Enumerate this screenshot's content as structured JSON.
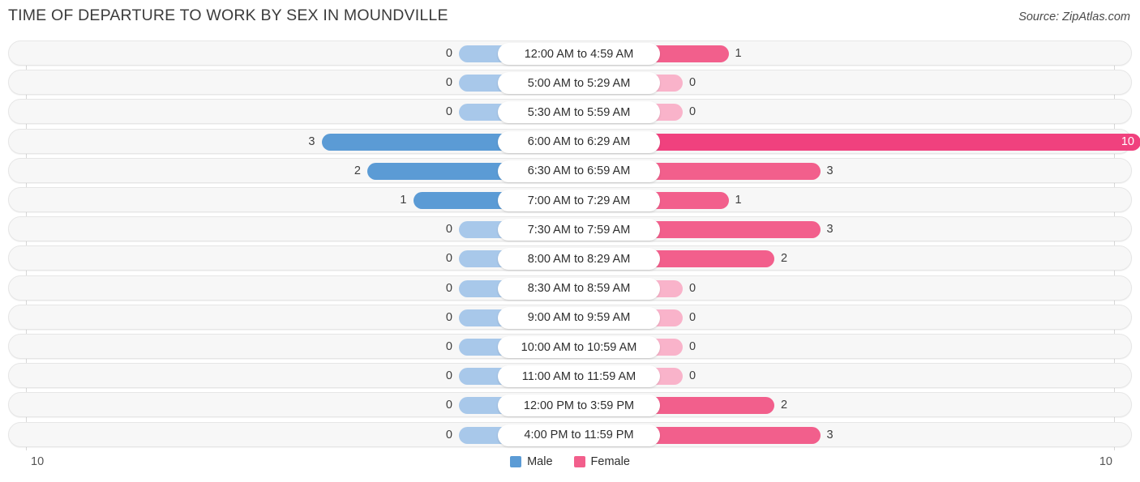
{
  "header": {
    "title": "TIME OF DEPARTURE TO WORK BY SEX IN MOUNDVILLE",
    "source": "Source: ZipAtlas.com"
  },
  "legend": {
    "male_label": "Male",
    "female_label": "Female",
    "male_color": "#5b9bd5",
    "female_color": "#f25f8c"
  },
  "axis": {
    "left_tick": "10",
    "right_tick": "10"
  },
  "colors": {
    "male_strong": "#5b9bd5",
    "male_light": "#a8c8ea",
    "female_strong": "#f25f8c",
    "female_light": "#f9b3ca",
    "female_max": "#f0417e"
  },
  "chart_data": {
    "type": "bar",
    "title": "TIME OF DEPARTURE TO WORK BY SEX IN MOUNDVILLE",
    "xlabel": "",
    "ylabel": "",
    "orientation": "horizontal-diverging",
    "xlim": [
      10,
      10
    ],
    "grid": false,
    "legend_position": "bottom-center",
    "categories": [
      "12:00 AM to 4:59 AM",
      "5:00 AM to 5:29 AM",
      "5:30 AM to 5:59 AM",
      "6:00 AM to 6:29 AM",
      "6:30 AM to 6:59 AM",
      "7:00 AM to 7:29 AM",
      "7:30 AM to 7:59 AM",
      "8:00 AM to 8:29 AM",
      "8:30 AM to 8:59 AM",
      "9:00 AM to 9:59 AM",
      "10:00 AM to 10:59 AM",
      "11:00 AM to 11:59 AM",
      "12:00 PM to 3:59 PM",
      "4:00 PM to 11:59 PM"
    ],
    "series": [
      {
        "name": "Male",
        "values": [
          0,
          0,
          0,
          3,
          2,
          1,
          0,
          0,
          0,
          0,
          0,
          0,
          0,
          0
        ]
      },
      {
        "name": "Female",
        "values": [
          1,
          0,
          0,
          10,
          3,
          1,
          3,
          2,
          0,
          0,
          0,
          0,
          2,
          3
        ]
      }
    ]
  },
  "rows": [
    {
      "category": "12:00 AM to 4:59 AM",
      "male": "0",
      "female": "1"
    },
    {
      "category": "5:00 AM to 5:29 AM",
      "male": "0",
      "female": "0"
    },
    {
      "category": "5:30 AM to 5:59 AM",
      "male": "0",
      "female": "0"
    },
    {
      "category": "6:00 AM to 6:29 AM",
      "male": "3",
      "female": "10"
    },
    {
      "category": "6:30 AM to 6:59 AM",
      "male": "2",
      "female": "3"
    },
    {
      "category": "7:00 AM to 7:29 AM",
      "male": "1",
      "female": "1"
    },
    {
      "category": "7:30 AM to 7:59 AM",
      "male": "0",
      "female": "3"
    },
    {
      "category": "8:00 AM to 8:29 AM",
      "male": "0",
      "female": "2"
    },
    {
      "category": "8:30 AM to 8:59 AM",
      "male": "0",
      "female": "0"
    },
    {
      "category": "9:00 AM to 9:59 AM",
      "male": "0",
      "female": "0"
    },
    {
      "category": "10:00 AM to 10:59 AM",
      "male": "0",
      "female": "0"
    },
    {
      "category": "11:00 AM to 11:59 AM",
      "male": "0",
      "female": "0"
    },
    {
      "category": "12:00 PM to 3:59 PM",
      "male": "0",
      "female": "2"
    },
    {
      "category": "4:00 PM to 11:59 PM",
      "male": "0",
      "female": "3"
    }
  ]
}
